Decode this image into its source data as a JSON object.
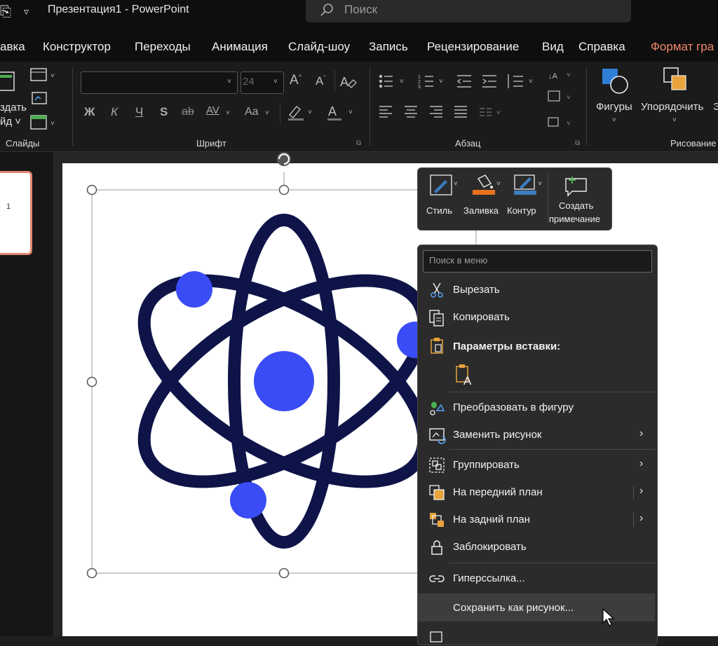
{
  "titlebar": {
    "title": "Презентация1  -  PowerPoint",
    "search_placeholder": "Поиск"
  },
  "tabs": [
    {
      "label": "авка"
    },
    {
      "label": "Конструктор"
    },
    {
      "label": "Переходы"
    },
    {
      "label": "Анимация"
    },
    {
      "label": "Слайд-шоу"
    },
    {
      "label": "Запись"
    },
    {
      "label": "Рецензирование"
    },
    {
      "label": "Вид"
    },
    {
      "label": "Справка"
    },
    {
      "label": "Формат гра"
    }
  ],
  "ribbon": {
    "slides_btn_line1": "здать",
    "slides_btn_line2": "йд ˅",
    "font_size": "24",
    "format_buttons": [
      "Ж",
      "К",
      "Ч",
      "S",
      "ab",
      "AV",
      "Aa"
    ],
    "groups": {
      "slides": "Слайды",
      "font": "Шрифт",
      "paragraph": "Абзац",
      "drawing": "Рисование"
    },
    "shapes_label": "Фигуры",
    "arrange_label": "Упорядочить",
    "cut_off_text": "Э"
  },
  "slide_thumb": {
    "number": "1"
  },
  "mini_toolbar": {
    "style": "Стиль",
    "fill": "Заливка",
    "outline": "Контур",
    "comment_line1": "Создать",
    "comment_line2": "примечание"
  },
  "context_menu": {
    "search_placeholder": "Поиск в меню",
    "items": [
      {
        "label": "Вырезать"
      },
      {
        "label": "Копировать"
      },
      {
        "label": "Параметры вставки:"
      },
      {
        "label": "Преобразовать в фигуру"
      },
      {
        "label": "Заменить рисунок"
      },
      {
        "label": "Группировать"
      },
      {
        "label": "На передний план"
      },
      {
        "label": "На задний план"
      },
      {
        "label": "Заблокировать"
      },
      {
        "label": "Гиперссылка..."
      },
      {
        "label": "Сохранить как рисунок..."
      }
    ]
  },
  "colors": {
    "accent_tab": "#f0896b",
    "atom_orbit": "#0e1448",
    "atom_electron": "#3a4cf5",
    "fill_swatch": "#e8711e",
    "outline_swatch": "#3b7dbf"
  }
}
